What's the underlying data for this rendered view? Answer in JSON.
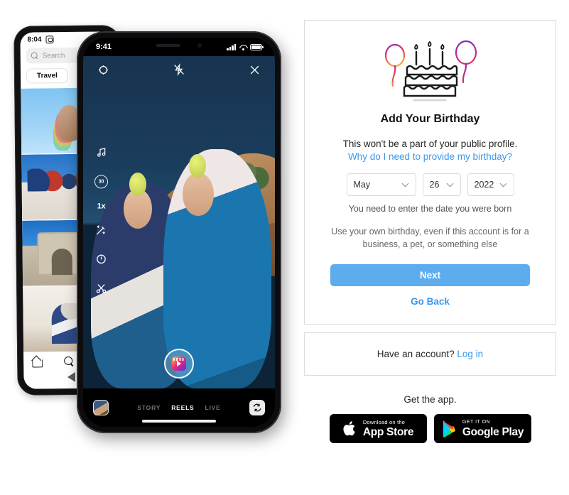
{
  "phone_back": {
    "status_time": "8:04",
    "status_icon": "instagram-camera-icon",
    "search_placeholder": "Search",
    "category_pill": "Travel",
    "tiles": [
      {
        "name": "henna-hand-photo"
      },
      {
        "name": "group-of-friends-photo"
      },
      {
        "name": "triumph-arch-photo"
      },
      {
        "name": "woman-eating-photo"
      }
    ],
    "nav": [
      "home-icon",
      "search-icon",
      "android-back-button"
    ]
  },
  "phone_front": {
    "status_time": "9:41",
    "status_icons": [
      "signal-bars",
      "wifi-icon",
      "battery-icon"
    ],
    "top_controls": [
      "camera-settings-icon",
      "flash-off-icon",
      "close-icon"
    ],
    "left_rail": [
      {
        "name": "audio-icon",
        "label": ""
      },
      {
        "name": "timer-duration-icon",
        "label": "30"
      },
      {
        "name": "speed-icon",
        "label": "1x"
      },
      {
        "name": "effects-icon",
        "label": ""
      },
      {
        "name": "timer-icon",
        "label": ""
      },
      {
        "name": "trim-scissors-icon",
        "label": ""
      }
    ],
    "record_button": "reels-record-button",
    "gallery_thumb": "gallery-thumbnail",
    "modes": [
      {
        "label": "STORY",
        "active": false
      },
      {
        "label": "REELS",
        "active": true
      },
      {
        "label": "LIVE",
        "active": false
      }
    ],
    "flip_button": "camera-flip-icon"
  },
  "signup": {
    "illustration": "birthday-cake-with-balloons",
    "title": "Add Your Birthday",
    "subtitle": "This won't be a part of your public profile.",
    "why_link": "Why do I need to provide my birthday?",
    "month": "May",
    "day": "26",
    "year": "2022",
    "hint": "You need to enter the date you were born",
    "note": "Use your own birthday, even if this account is for a business, a pet, or something else",
    "next_label": "Next",
    "go_back_label": "Go Back"
  },
  "login_card": {
    "prompt": "Have an account?",
    "link": "Log in"
  },
  "footer": {
    "get_the_app": "Get the app.",
    "app_store": {
      "small": "Download on the",
      "big": "App Store"
    },
    "google_play": {
      "small": "GET IT ON",
      "big": "Google Play"
    }
  },
  "colors": {
    "accent_link": "#3897f0",
    "next_button": "#5cacee",
    "border": "#dbdbdb",
    "text": "#262626"
  }
}
